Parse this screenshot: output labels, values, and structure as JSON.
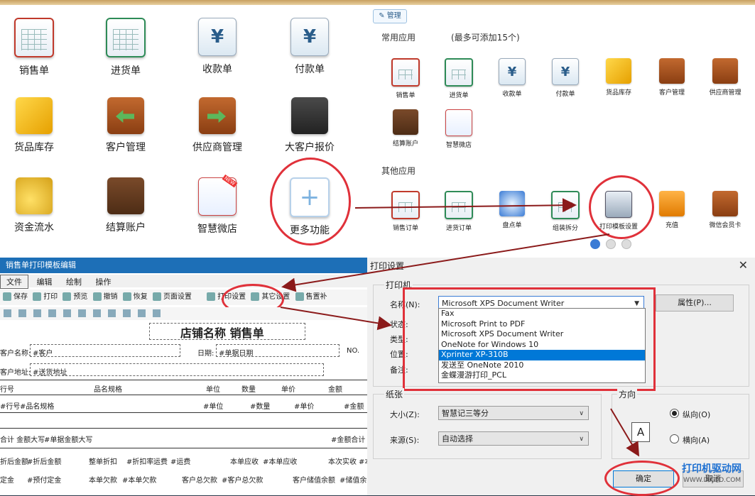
{
  "apps_large": [
    {
      "label": "销售单",
      "icon": "sales-doc-icon"
    },
    {
      "label": "进货单",
      "icon": "purchase-doc-icon"
    },
    {
      "label": "收款单",
      "icon": "receipt-yen-icon"
    },
    {
      "label": "付款单",
      "icon": "payment-yen-icon"
    },
    {
      "label": "货品库存",
      "icon": "inventory-box-icon"
    },
    {
      "label": "客户管理",
      "icon": "customer-folder-icon"
    },
    {
      "label": "供应商管理",
      "icon": "supplier-folder-icon"
    },
    {
      "label": "大客户报价",
      "icon": "price-tag-icon"
    },
    {
      "label": "资金流水",
      "icon": "coins-icon"
    },
    {
      "label": "结算账户",
      "icon": "account-book-icon"
    },
    {
      "label": "智慧微店",
      "icon": "shop-icon"
    },
    {
      "label": "更多功能",
      "icon": "plus-icon"
    }
  ],
  "new_badge": "NEW",
  "manage_button": "管理",
  "common_apps_title": "常用应用",
  "common_apps_hint": "(最多可添加15个)",
  "common_apps": [
    "销售单",
    "进货单",
    "收款单",
    "付款单",
    "货品库存",
    "客户管理",
    "供应商管理",
    "结算账户",
    "智慧微店"
  ],
  "other_apps_title": "其他应用",
  "other_apps": [
    "销售订单",
    "进货订单",
    "盘点单",
    "组装拆分",
    "打印模板设置",
    "充值",
    "微信会员卡"
  ],
  "editor": {
    "title": "销售单打印模板编辑",
    "menu": [
      "文件",
      "编辑",
      "绘制",
      "操作"
    ],
    "toolbar": [
      "保存",
      "打印",
      "预览",
      "撤销",
      "恢复",
      "页面设置",
      "打印设置",
      "其它设置",
      "售置补"
    ],
    "report_title": "店铺名称 销售单",
    "customer_label": "客户名称:",
    "customer_value": "#客户",
    "date_label": "日期:",
    "date_value": "#单据日期",
    "no_label": "NO.",
    "address_label": "客户地址:",
    "address_value": "#送货地址",
    "columns": [
      "行号",
      "品名规格",
      "单位",
      "数量",
      "单价",
      "金额"
    ],
    "row_values": [
      "#行号",
      "#品名规格",
      "#单位",
      "#数量",
      "#单价",
      "#金额"
    ],
    "total_label": "合计 金额大写",
    "total_value": "#单据金额大写",
    "total_amount": "#金额合计",
    "footer_row1": [
      "折后金额",
      "#折后金额",
      "整单折扣",
      "#折扣率",
      "运费",
      "#运费",
      "本单应收",
      "#本单应收",
      "本次实收",
      "#本"
    ],
    "footer_row2": [
      "定金",
      "#预付定金",
      "本单欠款",
      "#本单欠款",
      "客户总欠款",
      "#客户总欠款",
      "客户储值余额",
      "#储值余"
    ]
  },
  "print_dialog": {
    "title": "打印设置",
    "close": "✕",
    "printer_group": "打印机",
    "name_label": "名称(N):",
    "selected_printer": "Microsoft XPS Document Writer",
    "properties_button": "属性(P)...",
    "status_label": "状态:",
    "type_label": "类型:",
    "location_label": "位置:",
    "comment_label": "备注:",
    "printer_options": [
      "Fax",
      "Microsoft Print to PDF",
      "Microsoft XPS Document Writer",
      "OneNote for Windows 10",
      "Xprinter XP-310B",
      "发送至 OneNote 2010",
      "金蝶漫游打印_PCL"
    ],
    "highlighted_option": "Xprinter XP-310B",
    "paper_group": "纸张",
    "size_label": "大小(Z):",
    "size_value": "智慧记三等分",
    "source_label": "来源(S):",
    "source_value": "自动选择",
    "orientation_group": "方向",
    "portrait_label": "纵向(O)",
    "landscape_label": "横向(A)",
    "orientation_selected": "portrait",
    "ok_button": "确定",
    "cancel_button": "取消"
  },
  "watermark": {
    "title": "打印机驱动网",
    "url": "WWW.DYJQD.COM"
  },
  "colors": {
    "accent": "#1d6fb7",
    "highlight": "#0078d7",
    "annotation": "#e0313a",
    "arrow": "#8b1a1a"
  }
}
